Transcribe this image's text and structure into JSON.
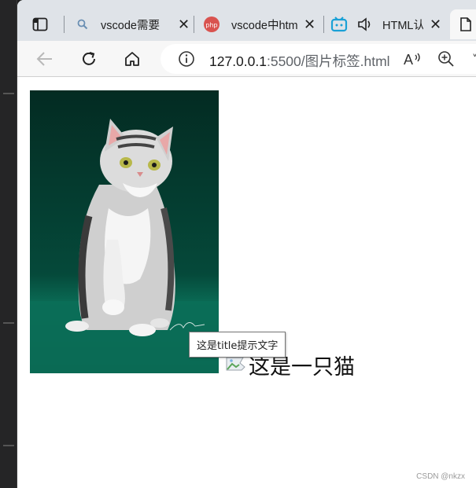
{
  "tabs": [
    {
      "label": "vscode需要",
      "icon": "search-icon"
    },
    {
      "label": "vscode中htm",
      "icon": "php-logo-icon"
    },
    {
      "label": "HTML认",
      "icon": "bilibili-tv-icon",
      "audio": "speaker-icon"
    },
    {
      "label": "",
      "icon": "page-icon"
    }
  ],
  "address_bar": {
    "host": "127.0.0.1",
    "port_path": ":5500/图片标签.html"
  },
  "page": {
    "alt_text": "这是一只猫",
    "tooltip": "这是title提示文字"
  },
  "watermark": "CSDN @nkzx"
}
